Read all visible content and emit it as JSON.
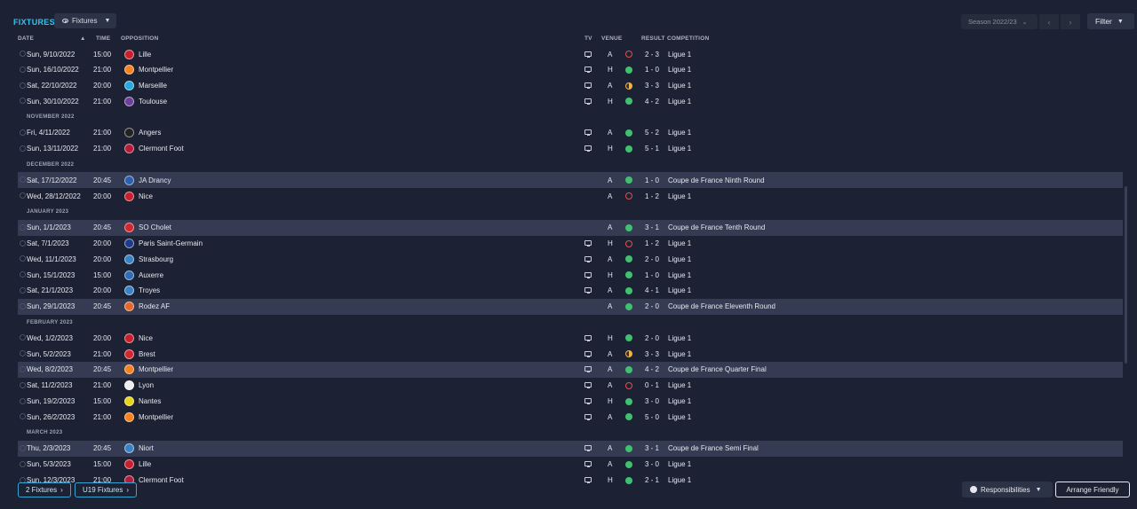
{
  "header": {
    "title": "FIXTURES",
    "view_label": "Fixtures",
    "season_label": "Season 2022/23",
    "filter_label": "Filter"
  },
  "columns": {
    "date": "DATE",
    "time": "TIME",
    "opposition": "OPPOSITION",
    "tv": "TV",
    "venue": "VENUE",
    "result": "RESULT",
    "competition": "COMPETITION"
  },
  "rows": [
    {
      "kind": "match",
      "date": "Sun, 9/10/2022",
      "time": "15:00",
      "team": "Lille",
      "tv": true,
      "venue": "A",
      "outcome": "L",
      "score": "2 - 3",
      "comp": "Ligue 1",
      "cup": false,
      "color": "#c8202e"
    },
    {
      "kind": "match",
      "date": "Sun, 16/10/2022",
      "time": "21:00",
      "team": "Montpellier",
      "tv": true,
      "venue": "H",
      "outcome": "W",
      "score": "1 - 0",
      "comp": "Ligue 1",
      "cup": false,
      "color": "#f58220"
    },
    {
      "kind": "match",
      "date": "Sat, 22/10/2022",
      "time": "20:00",
      "team": "Marseille",
      "tv": true,
      "venue": "A",
      "outcome": "D",
      "score": "3 - 3",
      "comp": "Ligue 1",
      "cup": false,
      "color": "#2aa7df"
    },
    {
      "kind": "match",
      "date": "Sun, 30/10/2022",
      "time": "21:00",
      "team": "Toulouse",
      "tv": true,
      "venue": "H",
      "outcome": "W",
      "score": "4 - 2",
      "comp": "Ligue 1",
      "cup": false,
      "color": "#6c3f98"
    },
    {
      "kind": "month",
      "label": "NOVEMBER 2022"
    },
    {
      "kind": "match",
      "date": "Fri, 4/11/2022",
      "time": "21:00",
      "team": "Angers",
      "tv": true,
      "venue": "A",
      "outcome": "W",
      "score": "5 - 2",
      "comp": "Ligue 1",
      "cup": false,
      "color": "#222222"
    },
    {
      "kind": "match",
      "date": "Sun, 13/11/2022",
      "time": "21:00",
      "team": "Clermont Foot",
      "tv": true,
      "venue": "H",
      "outcome": "W",
      "score": "5 - 1",
      "comp": "Ligue 1",
      "cup": false,
      "color": "#b51c3c"
    },
    {
      "kind": "month",
      "label": "DECEMBER 2022"
    },
    {
      "kind": "match",
      "date": "Sat, 17/12/2022",
      "time": "20:45",
      "team": "JA Drancy",
      "tv": false,
      "venue": "A",
      "outcome": "W",
      "score": "1 - 0",
      "comp": "Coupe de France Ninth Round",
      "cup": true,
      "color": "#2c5fb0"
    },
    {
      "kind": "match",
      "date": "Wed, 28/12/2022",
      "time": "20:00",
      "team": "Nice",
      "tv": false,
      "venue": "A",
      "outcome": "L",
      "score": "1 - 2",
      "comp": "Ligue 1",
      "cup": false,
      "color": "#c8202e"
    },
    {
      "kind": "month",
      "label": "JANUARY 2023"
    },
    {
      "kind": "match",
      "date": "Sun, 1/1/2023",
      "time": "20:45",
      "team": "SO Cholet",
      "tv": false,
      "venue": "A",
      "outcome": "W",
      "score": "3 - 1",
      "comp": "Coupe de France Tenth Round",
      "cup": true,
      "color": "#d22630"
    },
    {
      "kind": "match",
      "date": "Sat, 7/1/2023",
      "time": "20:00",
      "team": "Paris Saint-Germain",
      "tv": true,
      "venue": "H",
      "outcome": "L",
      "score": "1 - 2",
      "comp": "Ligue 1",
      "cup": false,
      "color": "#1e3a8a"
    },
    {
      "kind": "match",
      "date": "Wed, 11/1/2023",
      "time": "20:00",
      "team": "Strasbourg",
      "tv": true,
      "venue": "A",
      "outcome": "W",
      "score": "2 - 0",
      "comp": "Ligue 1",
      "cup": false,
      "color": "#3b82c4"
    },
    {
      "kind": "match",
      "date": "Sun, 15/1/2023",
      "time": "15:00",
      "team": "Auxerre",
      "tv": true,
      "venue": "H",
      "outcome": "W",
      "score": "1 - 0",
      "comp": "Ligue 1",
      "cup": false,
      "color": "#2f6db5"
    },
    {
      "kind": "match",
      "date": "Sat, 21/1/2023",
      "time": "20:00",
      "team": "Troyes",
      "tv": true,
      "venue": "A",
      "outcome": "W",
      "score": "4 - 1",
      "comp": "Ligue 1",
      "cup": false,
      "color": "#3b82c4"
    },
    {
      "kind": "match",
      "date": "Sun, 29/1/2023",
      "time": "20:45",
      "team": "Rodez AF",
      "tv": false,
      "venue": "A",
      "outcome": "W",
      "score": "2 - 0",
      "comp": "Coupe de France Eleventh Round",
      "cup": true,
      "color": "#e2682b"
    },
    {
      "kind": "month",
      "label": "FEBRUARY 2023"
    },
    {
      "kind": "match",
      "date": "Wed, 1/2/2023",
      "time": "20:00",
      "team": "Nice",
      "tv": true,
      "venue": "H",
      "outcome": "W",
      "score": "2 - 0",
      "comp": "Ligue 1",
      "cup": false,
      "color": "#c8202e"
    },
    {
      "kind": "match",
      "date": "Sun, 5/2/2023",
      "time": "21:00",
      "team": "Brest",
      "tv": true,
      "venue": "A",
      "outcome": "D",
      "score": "3 - 3",
      "comp": "Ligue 1",
      "cup": false,
      "color": "#d22630"
    },
    {
      "kind": "match",
      "date": "Wed, 8/2/2023",
      "time": "20:45",
      "team": "Montpellier",
      "tv": true,
      "venue": "A",
      "outcome": "W",
      "score": "4 - 2",
      "comp": "Coupe de France Quarter Final",
      "cup": true,
      "color": "#f58220"
    },
    {
      "kind": "match",
      "date": "Sat, 11/2/2023",
      "time": "21:00",
      "team": "Lyon",
      "tv": true,
      "venue": "A",
      "outcome": "L",
      "score": "0 - 1",
      "comp": "Ligue 1",
      "cup": false,
      "color": "#eeeeee"
    },
    {
      "kind": "match",
      "date": "Sun, 19/2/2023",
      "time": "15:00",
      "team": "Nantes",
      "tv": true,
      "venue": "H",
      "outcome": "W",
      "score": "3 - 0",
      "comp": "Ligue 1",
      "cup": false,
      "color": "#e8d31c"
    },
    {
      "kind": "match",
      "date": "Sun, 26/2/2023",
      "time": "21:00",
      "team": "Montpellier",
      "tv": true,
      "venue": "A",
      "outcome": "W",
      "score": "5 - 0",
      "comp": "Ligue 1",
      "cup": false,
      "color": "#f58220"
    },
    {
      "kind": "month",
      "label": "MARCH 2023"
    },
    {
      "kind": "match",
      "date": "Thu, 2/3/2023",
      "time": "20:45",
      "team": "Niort",
      "tv": true,
      "venue": "A",
      "outcome": "W",
      "score": "3 - 1",
      "comp": "Coupe de France Semi Final",
      "cup": true,
      "color": "#3b82c4"
    },
    {
      "kind": "match",
      "date": "Sun, 5/3/2023",
      "time": "15:00",
      "team": "Lille",
      "tv": true,
      "venue": "A",
      "outcome": "W",
      "score": "3 - 0",
      "comp": "Ligue 1",
      "cup": false,
      "color": "#c8202e"
    },
    {
      "kind": "match",
      "date": "Sun, 12/3/2023",
      "time": "21:00",
      "team": "Clermont Foot",
      "tv": true,
      "venue": "H",
      "outcome": "W",
      "score": "2 - 1",
      "comp": "Ligue 1",
      "cup": false,
      "color": "#b51c3c"
    }
  ],
  "footer": {
    "fixtures_2": "2 Fixtures",
    "u19_fixtures": "U19 Fixtures",
    "responsibilities": "Responsibilities",
    "arrange_friendly": "Arrange Friendly"
  }
}
